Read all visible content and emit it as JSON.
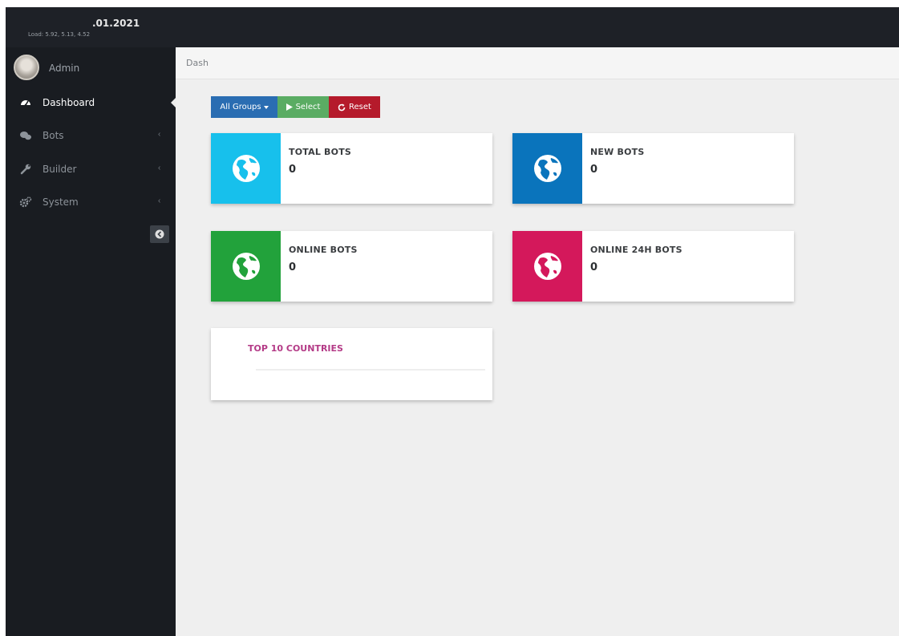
{
  "header": {
    "date": ".01.2021",
    "load": "Load: 5.92, 5.13, 4.52"
  },
  "sidebar": {
    "user": "Admin",
    "items": [
      {
        "label": "Dashboard",
        "icon": "dashboard-icon",
        "active": true
      },
      {
        "label": "Bots",
        "icon": "bots-icon",
        "active": false
      },
      {
        "label": "Builder",
        "icon": "wrench-icon",
        "active": false
      },
      {
        "label": "System",
        "icon": "gears-icon",
        "active": false
      }
    ],
    "collapse_icon": "arrow-left-circle-icon"
  },
  "breadcrumb": "Dash",
  "toolbar": {
    "groups_label": "All Groups",
    "select_label": "Select",
    "reset_label": "Reset"
  },
  "stats": [
    {
      "title": "TOTAL BOTS",
      "value": "0",
      "color": "#17c0ec"
    },
    {
      "title": "NEW BOTS",
      "value": "0",
      "color": "#0a74bc"
    },
    {
      "title": "ONLINE BOTS",
      "value": "0",
      "color": "#22a23b"
    },
    {
      "title": "ONLINE 24H BOTS",
      "value": "0",
      "color": "#d4185b"
    }
  ],
  "countries": {
    "title": "TOP 10 COUNTRIES",
    "title_color": "#b43b87"
  }
}
